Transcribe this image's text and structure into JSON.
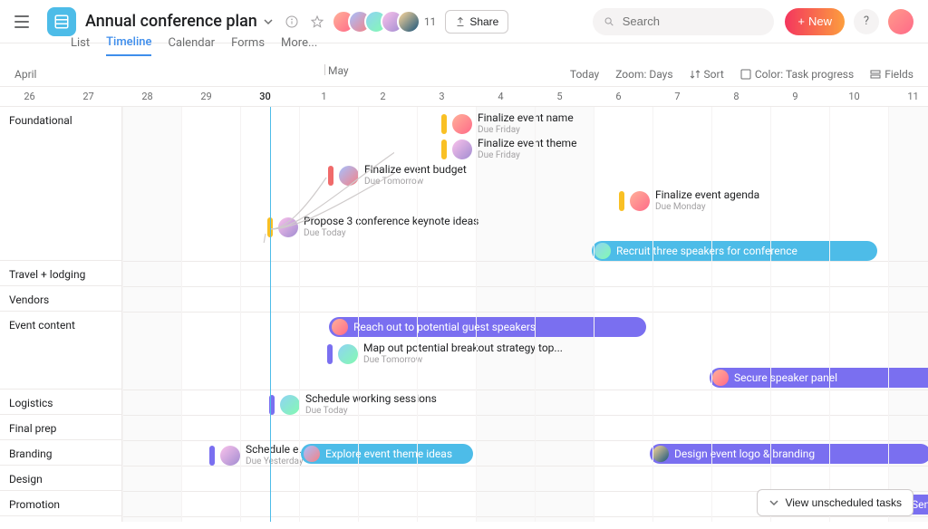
{
  "header": {
    "project_title": "Annual conference plan",
    "member_count": "11",
    "share_label": "Share",
    "search_placeholder": "Search",
    "new_label": "New",
    "help_label": "?"
  },
  "tabs": [
    {
      "label": "List",
      "active": false
    },
    {
      "label": "Timeline",
      "active": true
    },
    {
      "label": "Calendar",
      "active": false
    },
    {
      "label": "Forms",
      "active": false
    },
    {
      "label": "More...",
      "active": false
    }
  ],
  "months": {
    "left": "April",
    "right": "May"
  },
  "toolbar": {
    "today": "Today",
    "zoom": "Zoom: Days",
    "sort": "Sort",
    "color": "Color: Task progress",
    "fields": "Fields"
  },
  "dates": [
    "26",
    "27",
    "28",
    "29",
    "30",
    "1",
    "2",
    "3",
    "4",
    "5",
    "6",
    "7",
    "8",
    "9",
    "10",
    "11"
  ],
  "today_index": 4,
  "sections": [
    {
      "label": "Foundational"
    },
    {
      "label": "Travel + lodging"
    },
    {
      "label": "Vendors"
    },
    {
      "label": "Event content"
    },
    {
      "label": "Logistics"
    },
    {
      "label": "Final prep"
    },
    {
      "label": "Branding"
    },
    {
      "label": "Design"
    },
    {
      "label": "Promotion"
    }
  ],
  "tasks": {
    "foundational": {
      "finalize_name": {
        "title": "Finalize event name",
        "due": "Due Friday"
      },
      "finalize_theme": {
        "title": "Finalize event theme",
        "due": "Due Friday"
      },
      "finalize_budget": {
        "title": "Finalize event budget",
        "due": "Due Tomorrow"
      },
      "propose_keynote": {
        "title": "Propose 3 conference keynote ideas",
        "due": "Due Today"
      },
      "finalize_agenda": {
        "title": "Finalize event agenda",
        "due": "Due Monday"
      },
      "recruit_speakers": {
        "title": "Recruit three speakers for conference"
      }
    },
    "event_content": {
      "reach_out": {
        "title": "Reach out to potential guest speakers"
      },
      "map_out": {
        "title": "Map out potential breakout strategy top...",
        "due": "Due Tomorrow"
      },
      "secure_panel": {
        "title": "Secure speaker panel"
      }
    },
    "logistics": {
      "schedule_sessions": {
        "title": "Schedule working sessions",
        "due": "Due Today"
      }
    },
    "branding": {
      "schedule_event": {
        "title": "Schedule event ...",
        "due": "Due Yesterday"
      },
      "explore_theme": {
        "title": "Explore event theme ideas"
      },
      "design_logo": {
        "title": "Design event logo & branding"
      }
    },
    "promotion": {
      "save_date": {
        "title": "Send save the da"
      }
    }
  },
  "footer": {
    "unscheduled": "View unscheduled tasks"
  }
}
